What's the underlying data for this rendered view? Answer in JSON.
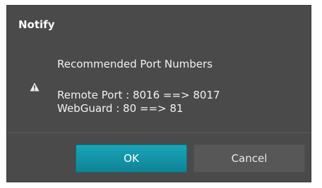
{
  "dialog": {
    "title": "Notify",
    "icon": "warning-icon",
    "headline": "Recommended Port Numbers",
    "lines": [
      "Remote Port : 8016 ==> 8017",
      "WebGuard : 80 ==> 81"
    ]
  },
  "buttons": {
    "ok_label": "OK",
    "cancel_label": "Cancel"
  },
  "colors": {
    "dialog_bg": "#4a4a4a",
    "ok_accent": "#1aa4b8",
    "cancel_bg": "#575757"
  }
}
